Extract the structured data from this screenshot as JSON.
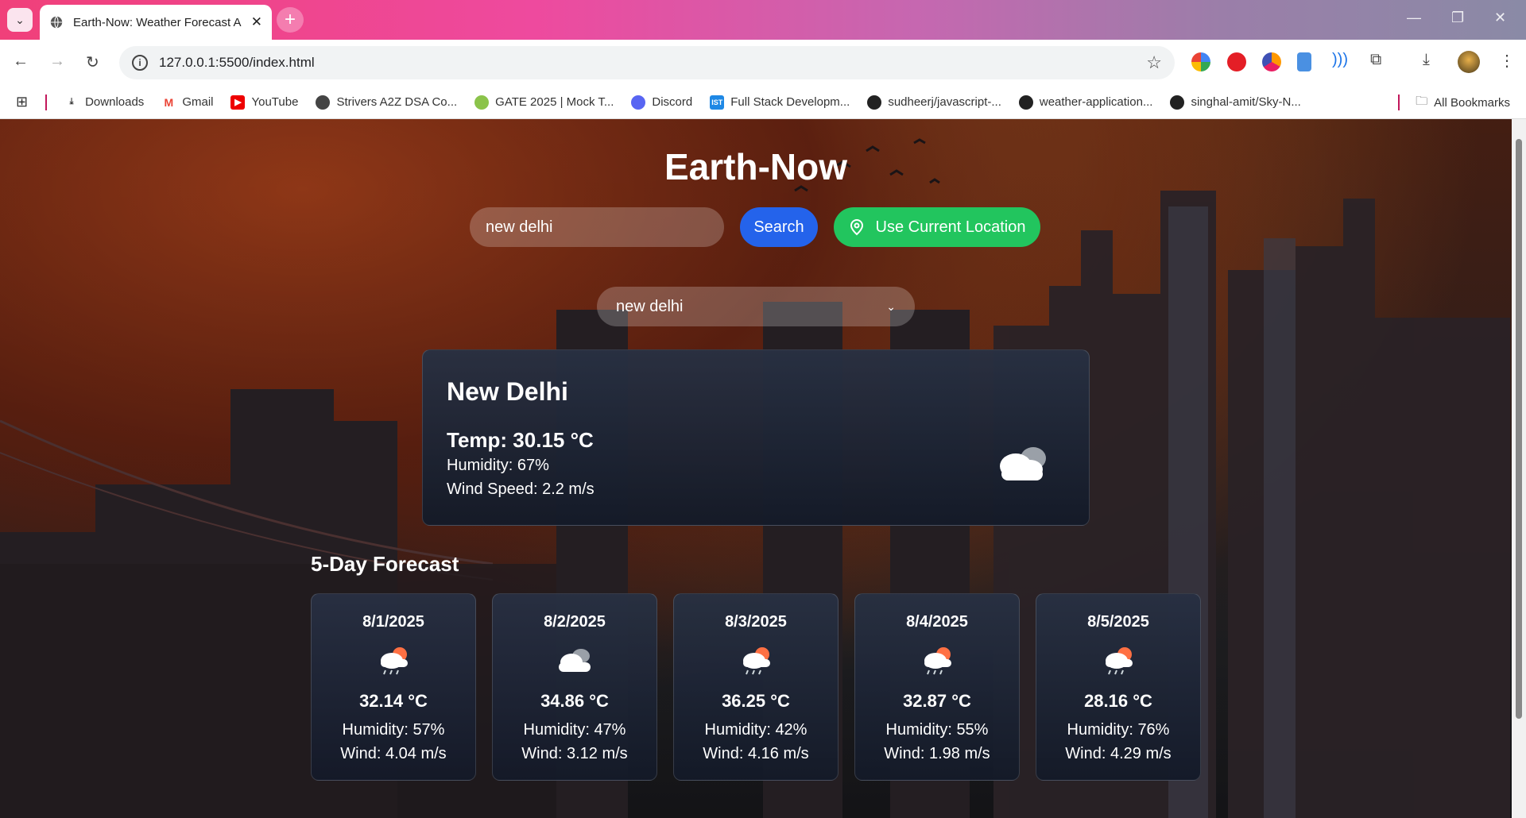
{
  "browser": {
    "tab_title": "Earth-Now: Weather Forecast A",
    "url": "127.0.0.1:5500/index.html",
    "bookmarks": [
      {
        "label": "Downloads",
        "icon": "download-icon"
      },
      {
        "label": "Gmail",
        "icon": "gmail-icon"
      },
      {
        "label": "YouTube",
        "icon": "youtube-icon"
      },
      {
        "label": "Strivers A2Z DSA Co...",
        "icon": "strivers-icon"
      },
      {
        "label": "GATE 2025 | Mock T...",
        "icon": "gate-icon"
      },
      {
        "label": "Discord",
        "icon": "discord-icon"
      },
      {
        "label": "Full Stack Developm...",
        "icon": "ist-icon"
      },
      {
        "label": "sudheerj/javascript-...",
        "icon": "github-icon"
      },
      {
        "label": "weather-application...",
        "icon": "github-icon"
      },
      {
        "label": "singhal-amit/Sky-N...",
        "icon": "github-icon"
      }
    ],
    "all_bookmarks": "All Bookmarks"
  },
  "app": {
    "title": "Earth-Now",
    "search_value": "new delhi",
    "search_label": "Search",
    "location_label": "Use Current Location",
    "select_value": "new delhi"
  },
  "current": {
    "city": "New Delhi",
    "temp": "Temp: 30.15 °C",
    "humidity": "Humidity: 67%",
    "wind": "Wind Speed: 2.2 m/s",
    "icon": "cloud-icon"
  },
  "forecast": {
    "title": "5-Day Forecast",
    "days": [
      {
        "date": "8/1/2025",
        "temp": "32.14 °C",
        "humidity": "Humidity: 57%",
        "wind": "Wind: 4.04 m/s",
        "icon": "rain-sun-icon"
      },
      {
        "date": "8/2/2025",
        "temp": "34.86 °C",
        "humidity": "Humidity: 47%",
        "wind": "Wind: 3.12 m/s",
        "icon": "cloud-icon"
      },
      {
        "date": "8/3/2025",
        "temp": "36.25 °C",
        "humidity": "Humidity: 42%",
        "wind": "Wind: 4.16 m/s",
        "icon": "rain-sun-icon"
      },
      {
        "date": "8/4/2025",
        "temp": "32.87 °C",
        "humidity": "Humidity: 55%",
        "wind": "Wind: 1.98 m/s",
        "icon": "rain-sun-icon"
      },
      {
        "date": "8/5/2025",
        "temp": "28.16 °C",
        "humidity": "Humidity: 76%",
        "wind": "Wind: 4.29 m/s",
        "icon": "rain-sun-icon"
      }
    ]
  },
  "colors": {
    "search_button": "#2463eb",
    "location_button": "#22c55e"
  }
}
